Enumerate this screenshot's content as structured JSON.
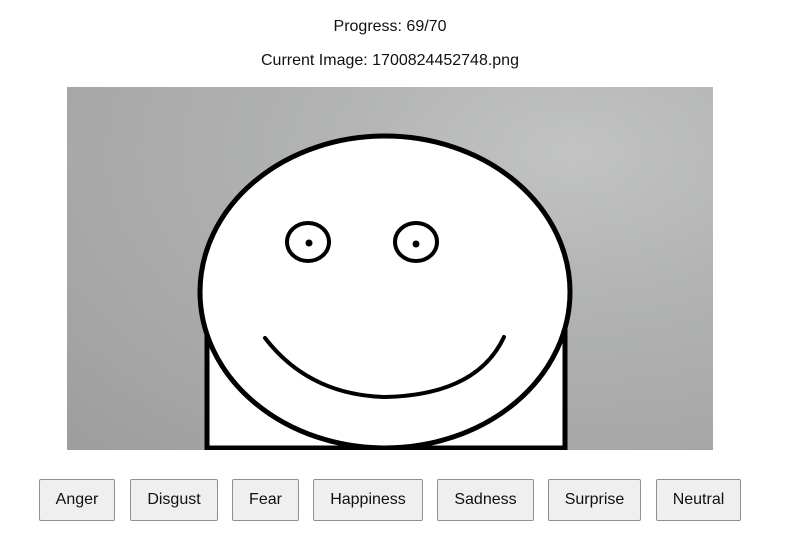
{
  "header": {
    "progress_text": "Progress: 69/70",
    "current_image_text": "Current Image: 1700824452748.png"
  },
  "image": {
    "subject": "hand-drawn smiley face on white paper",
    "background_color": "#aaaaaa"
  },
  "emotion_buttons": [
    "Anger",
    "Disgust",
    "Fear",
    "Happiness",
    "Sadness",
    "Surprise",
    "Neutral"
  ]
}
